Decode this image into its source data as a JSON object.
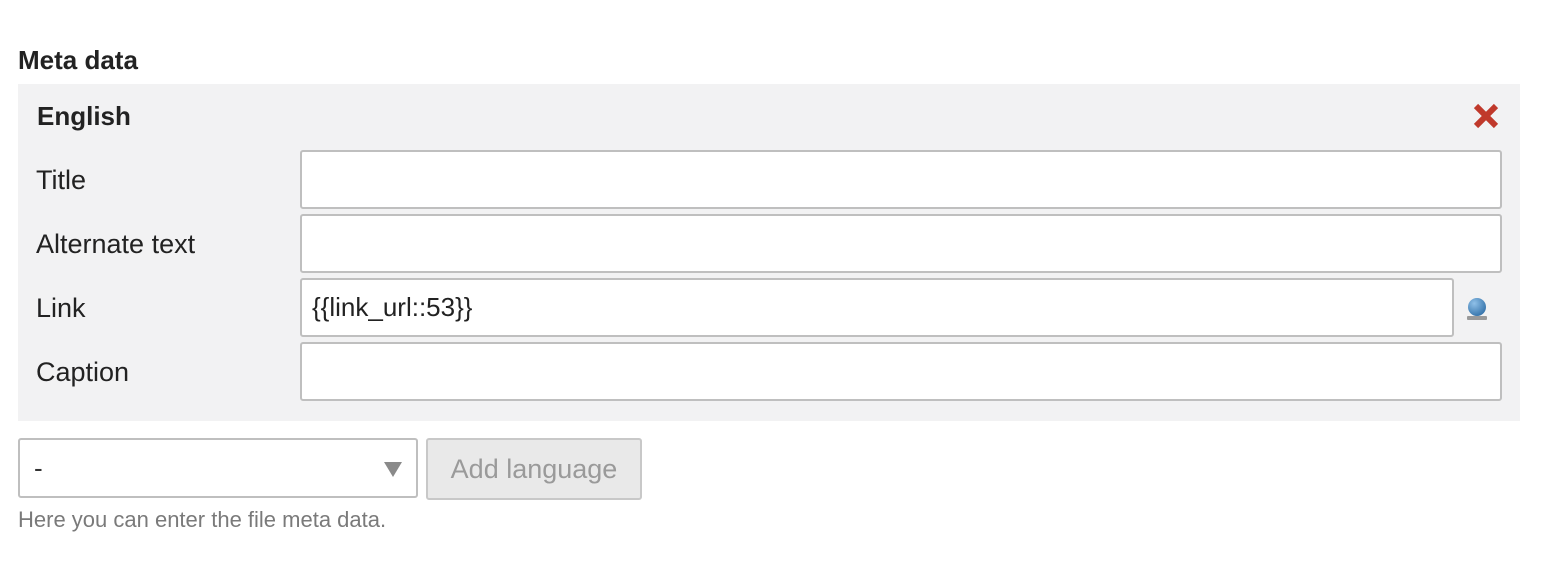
{
  "section": {
    "title": "Meta data"
  },
  "language_block": {
    "title": "English",
    "delete_icon": "close-x-icon",
    "delete_color": "#c0392b",
    "fields": {
      "title": {
        "label": "Title",
        "value": ""
      },
      "alt": {
        "label": "Alternate text",
        "value": ""
      },
      "link": {
        "label": "Link",
        "value": "{{link_url::53}}",
        "picker_icon": "globe-picker-icon",
        "picker_color": "#3a7ab8"
      },
      "caption": {
        "label": "Caption",
        "value": ""
      }
    }
  },
  "add_language": {
    "select_value": "-",
    "select_icon": "chevron-down-icon",
    "button_label": "Add language"
  },
  "help": {
    "text": "Here you can enter the file meta data."
  }
}
